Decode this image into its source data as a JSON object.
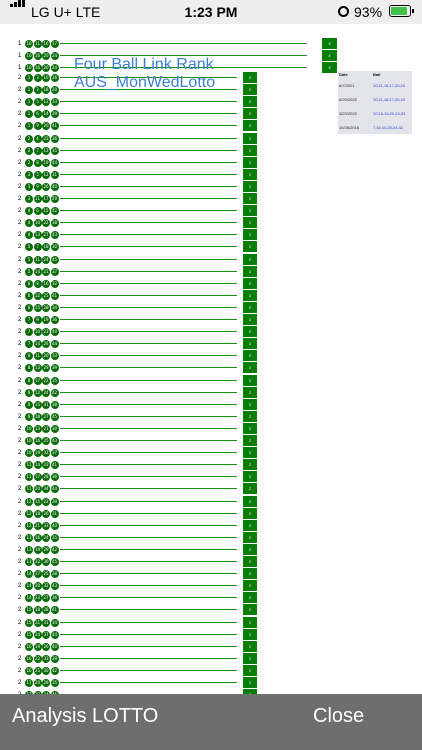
{
  "status_bar": {
    "carrier": "LG U+  LTE",
    "time": "1:23 PM",
    "battery_percent": "93%",
    "battery_level": 0.93,
    "icons": [
      "signal-icon",
      "orientation-lock-icon",
      "battery-charging-icon"
    ]
  },
  "chart": {
    "title": "Four Ball Link Rank",
    "subtitle": "AUS_MonWedLotto",
    "rows": [
      {
        "rank": "1",
        "balls": [
          "10",
          "11",
          "16",
          "17"
        ],
        "button": "4"
      },
      {
        "rank": "1",
        "balls": [
          "10",
          "16",
          "20",
          "24"
        ],
        "button": "4"
      },
      {
        "rank": "1",
        "balls": [
          "10",
          "16",
          "20",
          "24"
        ],
        "button": "4"
      },
      {
        "rank": "2",
        "balls": [
          "1",
          "3",
          "10",
          "16"
        ],
        "button": "2"
      },
      {
        "rank": "2",
        "balls": [
          "1",
          "3",
          "18",
          "20"
        ],
        "button": "2"
      },
      {
        "rank": "2",
        "balls": [
          "1",
          "5",
          "12",
          "33"
        ],
        "button": "2"
      },
      {
        "rank": "2",
        "balls": [
          "1",
          "6",
          "14",
          "39"
        ],
        "button": "2"
      },
      {
        "rank": "2",
        "balls": [
          "1",
          "9",
          "20",
          "41"
        ],
        "button": "2"
      },
      {
        "rank": "2",
        "balls": [
          "2",
          "4",
          "23",
          "36"
        ],
        "button": "2"
      },
      {
        "rank": "2",
        "balls": [
          "2",
          "7",
          "13",
          "35"
        ],
        "button": "2"
      },
      {
        "rank": "2",
        "balls": [
          "2",
          "8",
          "19",
          "44"
        ],
        "button": "2"
      },
      {
        "rank": "2",
        "balls": [
          "3",
          "5",
          "12",
          "31"
        ],
        "button": "2"
      },
      {
        "rank": "2",
        "balls": [
          "3",
          "9",
          "26",
          "40"
        ],
        "button": "2"
      },
      {
        "rank": "2",
        "balls": [
          "3",
          "11",
          "17",
          "29"
        ],
        "button": "2"
      },
      {
        "rank": "2",
        "balls": [
          "4",
          "6",
          "15",
          "42"
        ],
        "button": "2"
      },
      {
        "rank": "2",
        "balls": [
          "4",
          "10",
          "22",
          "38"
        ],
        "button": "2"
      },
      {
        "rank": "2",
        "balls": [
          "4",
          "13",
          "27",
          "43"
        ],
        "button": "2"
      },
      {
        "rank": "2",
        "balls": [
          "5",
          "7",
          "18",
          "30"
        ],
        "button": "2"
      },
      {
        "rank": "2",
        "balls": [
          "5",
          "11",
          "24",
          "45"
        ],
        "button": "2"
      },
      {
        "rank": "2",
        "balls": [
          "5",
          "14",
          "21",
          "37"
        ],
        "button": "2"
      },
      {
        "rank": "2",
        "balls": [
          "6",
          "8",
          "16",
          "32"
        ],
        "button": "2"
      },
      {
        "rank": "2",
        "balls": [
          "6",
          "12",
          "25",
          "41"
        ],
        "button": "2"
      },
      {
        "rank": "2",
        "balls": [
          "6",
          "15",
          "28",
          "34"
        ],
        "button": "2"
      },
      {
        "rank": "2",
        "balls": [
          "7",
          "9",
          "19",
          "36"
        ],
        "button": "2"
      },
      {
        "rank": "2",
        "balls": [
          "7",
          "10",
          "23",
          "40"
        ],
        "button": "2"
      },
      {
        "rank": "2",
        "balls": [
          "7",
          "14",
          "26",
          "44"
        ],
        "button": "2"
      },
      {
        "rank": "2",
        "balls": [
          "8",
          "11",
          "20",
          "33"
        ],
        "button": "2"
      },
      {
        "rank": "2",
        "balls": [
          "8",
          "13",
          "29",
          "39"
        ],
        "button": "2"
      },
      {
        "rank": "2",
        "balls": [
          "8",
          "17",
          "22",
          "35"
        ],
        "button": "2"
      },
      {
        "rank": "2",
        "balls": [
          "9",
          "12",
          "24",
          "42"
        ],
        "button": "2"
      },
      {
        "rank": "2",
        "balls": [
          "9",
          "15",
          "31",
          "38"
        ],
        "button": "2"
      },
      {
        "rank": "2",
        "balls": [
          "9",
          "18",
          "27",
          "45"
        ],
        "button": "2"
      },
      {
        "rank": "2",
        "balls": [
          "10",
          "13",
          "21",
          "30"
        ],
        "button": "2"
      },
      {
        "rank": "2",
        "balls": [
          "10",
          "16",
          "25",
          "43"
        ],
        "button": "2"
      },
      {
        "rank": "2",
        "balls": [
          "10",
          "19",
          "32",
          "37"
        ],
        "button": "2"
      },
      {
        "rank": "2",
        "balls": [
          "11",
          "14",
          "23",
          "41"
        ],
        "button": "2"
      },
      {
        "rank": "2",
        "balls": [
          "11",
          "17",
          "28",
          "36"
        ],
        "button": "2"
      },
      {
        "rank": "2",
        "balls": [
          "11",
          "20",
          "34",
          "44"
        ],
        "button": "2"
      },
      {
        "rank": "2",
        "balls": [
          "12",
          "15",
          "22",
          "39"
        ],
        "button": "2"
      },
      {
        "rank": "2",
        "balls": [
          "12",
          "18",
          "26",
          "31"
        ],
        "button": "2"
      },
      {
        "rank": "2",
        "balls": [
          "12",
          "21",
          "33",
          "40"
        ],
        "button": "2"
      },
      {
        "rank": "2",
        "balls": [
          "13",
          "16",
          "24",
          "35"
        ],
        "button": "2"
      },
      {
        "rank": "2",
        "balls": [
          "13",
          "19",
          "29",
          "42"
        ],
        "button": "2"
      },
      {
        "rank": "2",
        "balls": [
          "13",
          "22",
          "30",
          "45"
        ],
        "button": "2"
      },
      {
        "rank": "2",
        "balls": [
          "14",
          "17",
          "25",
          "38"
        ],
        "button": "2"
      },
      {
        "rank": "2",
        "balls": [
          "14",
          "20",
          "32",
          "43"
        ],
        "button": "2"
      },
      {
        "rank": "2",
        "balls": [
          "14",
          "23",
          "27",
          "36"
        ],
        "button": "2"
      },
      {
        "rank": "2",
        "balls": [
          "15",
          "18",
          "28",
          "41"
        ],
        "button": "2"
      },
      {
        "rank": "2",
        "balls": [
          "15",
          "21",
          "31",
          "34"
        ],
        "button": "2"
      },
      {
        "rank": "2",
        "balls": [
          "15",
          "24",
          "37",
          "44"
        ],
        "button": "2"
      },
      {
        "rank": "2",
        "balls": [
          "16",
          "19",
          "26",
          "40"
        ],
        "button": "2"
      },
      {
        "rank": "2",
        "balls": [
          "16",
          "22",
          "33",
          "39"
        ],
        "button": "2"
      },
      {
        "rank": "2",
        "balls": [
          "16",
          "25",
          "30",
          "42"
        ],
        "button": "2"
      },
      {
        "rank": "2",
        "balls": [
          "17",
          "20",
          "29",
          "35"
        ],
        "button": "2"
      },
      {
        "rank": "2",
        "balls": [
          "17",
          "23",
          "34",
          "45"
        ],
        "button": "2"
      },
      {
        "rank": "2",
        "balls": [
          "17",
          "26",
          "31",
          "38"
        ],
        "button": "2"
      }
    ]
  },
  "history": {
    "columns": [
      "Date",
      "Ball"
    ],
    "rows": [
      {
        "date": "6/7/2021",
        "balls": "10,11,16,17,20,24"
      },
      {
        "date": "6/29/2020",
        "balls": "10,11,16,17,20,24"
      },
      {
        "date": "3/23/2020",
        "balls": "10,16,16,20,24,43"
      },
      {
        "date": "10/26/2016",
        "balls": "7,10,15,20,24,42"
      }
    ]
  },
  "footer": {
    "left_label": "Analysis LOTTO",
    "right_label": "Close"
  },
  "colors": {
    "ball": "#0a6b0a",
    "line": "#1a8f1a",
    "title": "#3a7fd2",
    "footer_bg": "#6e6e6e",
    "history_bg": "#e3e3ea",
    "history_ball_text": "#2a3fd0"
  }
}
